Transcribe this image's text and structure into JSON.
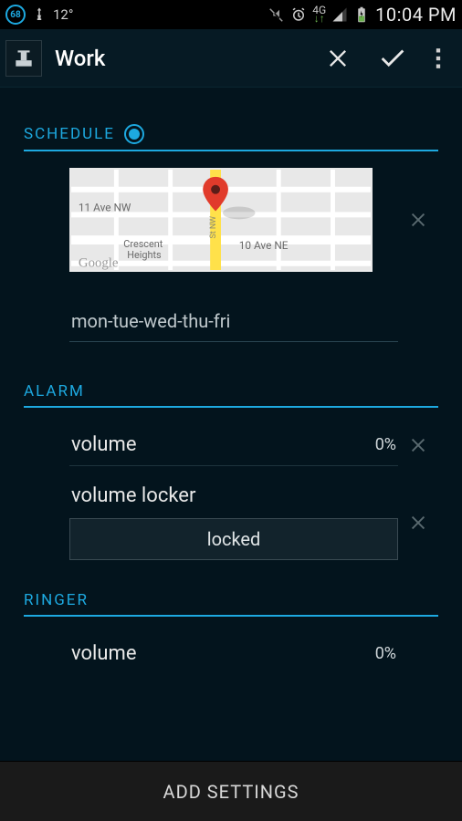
{
  "status_bar": {
    "battery_percent": "68",
    "temperature": "12°",
    "network_label": "4G",
    "clock": "10:04 PM"
  },
  "action_bar": {
    "title": "Work"
  },
  "sections": {
    "schedule": {
      "header": "SCHEDULE",
      "map_labels": {
        "nw": "11 Ave NW",
        "crescent": "Crescent\nHeights",
        "ne": "10 Ave NE",
        "logo": "Google",
        "street": "St NW"
      },
      "days_value": "mon-tue-wed-thu-fri"
    },
    "alarm": {
      "header": "ALARM",
      "volume_label": "volume",
      "volume_value": "0%",
      "volume_locker_label": "volume locker",
      "locked_button": "locked"
    },
    "ringer": {
      "header": "RINGER",
      "volume_label": "volume",
      "volume_value": "0%"
    }
  },
  "bottom_bar": {
    "label": "ADD SETTINGS"
  }
}
